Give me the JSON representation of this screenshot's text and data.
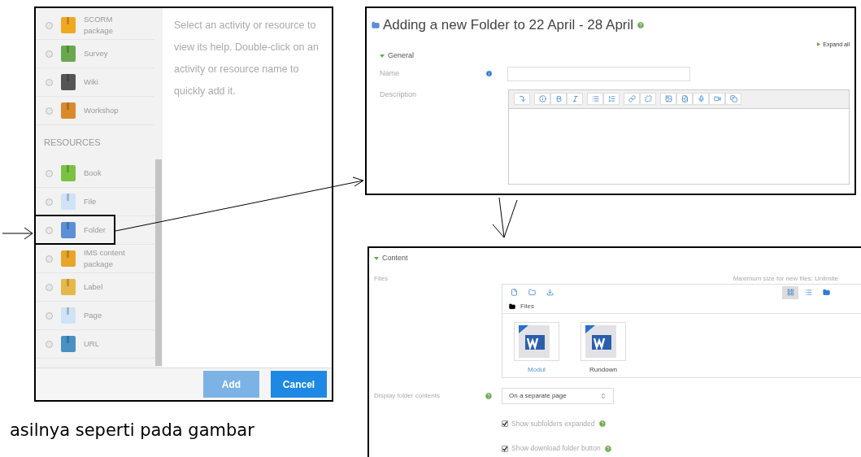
{
  "activity_chooser": {
    "items": [
      {
        "kind": "item",
        "label": "SCORM package",
        "highlighted": false,
        "selected": false
      },
      {
        "kind": "item",
        "label": "Survey",
        "highlighted": false,
        "selected": false
      },
      {
        "kind": "item",
        "label": "Wiki",
        "highlighted": false,
        "selected": false
      },
      {
        "kind": "item",
        "label": "Workshop",
        "highlighted": false,
        "selected": false
      },
      {
        "kind": "heading",
        "label": "RESOURCES"
      },
      {
        "kind": "item",
        "label": "Book",
        "highlighted": false,
        "selected": false
      },
      {
        "kind": "item",
        "label": "File",
        "highlighted": false,
        "selected": false
      },
      {
        "kind": "item",
        "label": "Folder",
        "highlighted": true,
        "selected": false
      },
      {
        "kind": "item",
        "label": "IMS content package",
        "highlighted": false,
        "selected": false
      },
      {
        "kind": "item",
        "label": "Label",
        "highlighted": false,
        "selected": false
      },
      {
        "kind": "item",
        "label": "Page",
        "highlighted": false,
        "selected": false
      },
      {
        "kind": "item",
        "label": "URL",
        "highlighted": false,
        "selected": false
      }
    ],
    "help_text": "Select an activity or resource to view its help. Double-click on an activity or resource name to quickly add it.",
    "buttons": [
      {
        "label": "Add",
        "disabled": true
      },
      {
        "label": "Cancel",
        "disabled": false
      }
    ]
  },
  "caption": "asilnya seperti pada gambar",
  "folder_form": {
    "title": "Adding a new Folder to 22 April - 28 April",
    "expand_all": "Expand all",
    "section": "General",
    "name_label": "Name",
    "description_label": "Description"
  },
  "content_form": {
    "section": "Content",
    "files_label": "Files",
    "max_size": "Maximum size for new files: Unlimite",
    "breadcrumb": "Files",
    "files": [
      {
        "name": "Modul",
        "highlighted": true
      },
      {
        "name": "Rundown",
        "highlighted": false
      }
    ],
    "display_label": "Display folder contents",
    "display_value": "On a separate page",
    "checkboxes": [
      {
        "label": "Show subfolders expanded",
        "checked": true
      },
      {
        "label": "Show download folder button",
        "checked": true
      }
    ]
  }
}
